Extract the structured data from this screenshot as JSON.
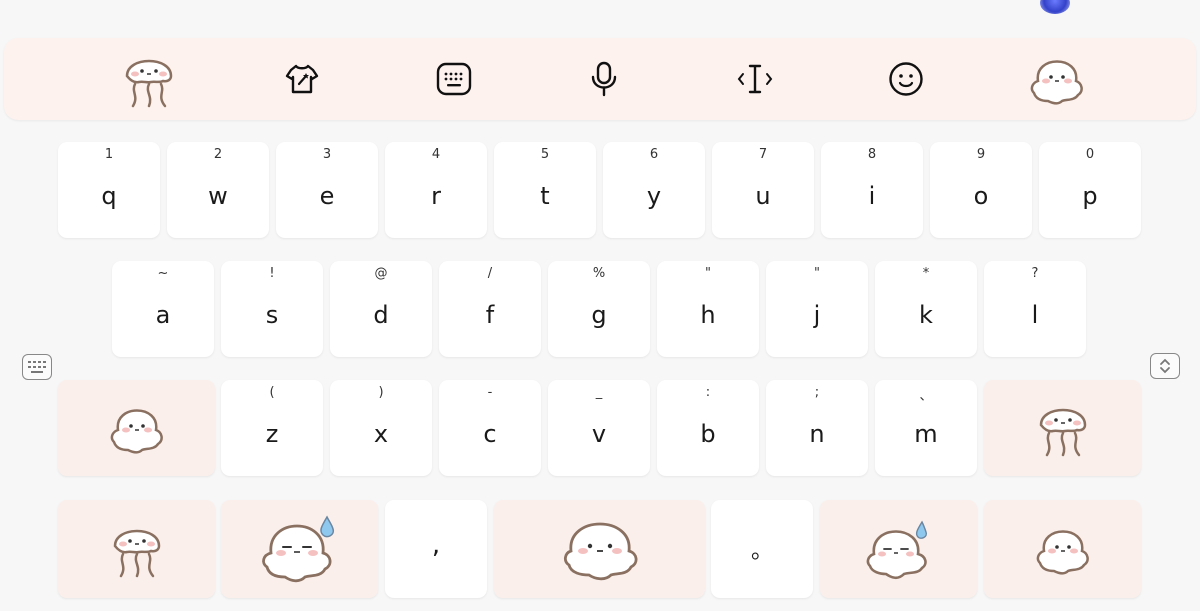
{
  "toolbar": {
    "items": [
      {
        "icon": "jellyfish-icon"
      },
      {
        "icon": "theme-shirt-icon"
      },
      {
        "icon": "keyboard-icon"
      },
      {
        "icon": "microphone-icon"
      },
      {
        "icon": "text-cursor-icon"
      },
      {
        "icon": "emoji-icon"
      },
      {
        "icon": "blob-character-icon"
      }
    ]
  },
  "rows": {
    "row1": [
      {
        "main": "q",
        "sub": "1"
      },
      {
        "main": "w",
        "sub": "2"
      },
      {
        "main": "e",
        "sub": "3"
      },
      {
        "main": "r",
        "sub": "4"
      },
      {
        "main": "t",
        "sub": "5"
      },
      {
        "main": "y",
        "sub": "6"
      },
      {
        "main": "u",
        "sub": "7"
      },
      {
        "main": "i",
        "sub": "8"
      },
      {
        "main": "o",
        "sub": "9"
      },
      {
        "main": "p",
        "sub": "0"
      }
    ],
    "row2": [
      {
        "main": "a",
        "sub": "~"
      },
      {
        "main": "s",
        "sub": "!"
      },
      {
        "main": "d",
        "sub": "@"
      },
      {
        "main": "f",
        "sub": "/"
      },
      {
        "main": "g",
        "sub": "%"
      },
      {
        "main": "h",
        "sub": "\""
      },
      {
        "main": "j",
        "sub": "\""
      },
      {
        "main": "k",
        "sub": "*"
      },
      {
        "main": "l",
        "sub": "?"
      }
    ],
    "row3": [
      {
        "main": "z",
        "sub": "("
      },
      {
        "main": "x",
        "sub": ")"
      },
      {
        "main": "c",
        "sub": "-"
      },
      {
        "main": "v",
        "sub": "_"
      },
      {
        "main": "b",
        "sub": ":"
      },
      {
        "main": "n",
        "sub": ";"
      },
      {
        "main": "m",
        "sub": "、"
      }
    ],
    "row4": {
      "comma": ",",
      "period": "。"
    }
  },
  "colors": {
    "accent_pink": "#fdf2ee",
    "key_white": "#ffffff",
    "background": "#f7f7f7"
  }
}
